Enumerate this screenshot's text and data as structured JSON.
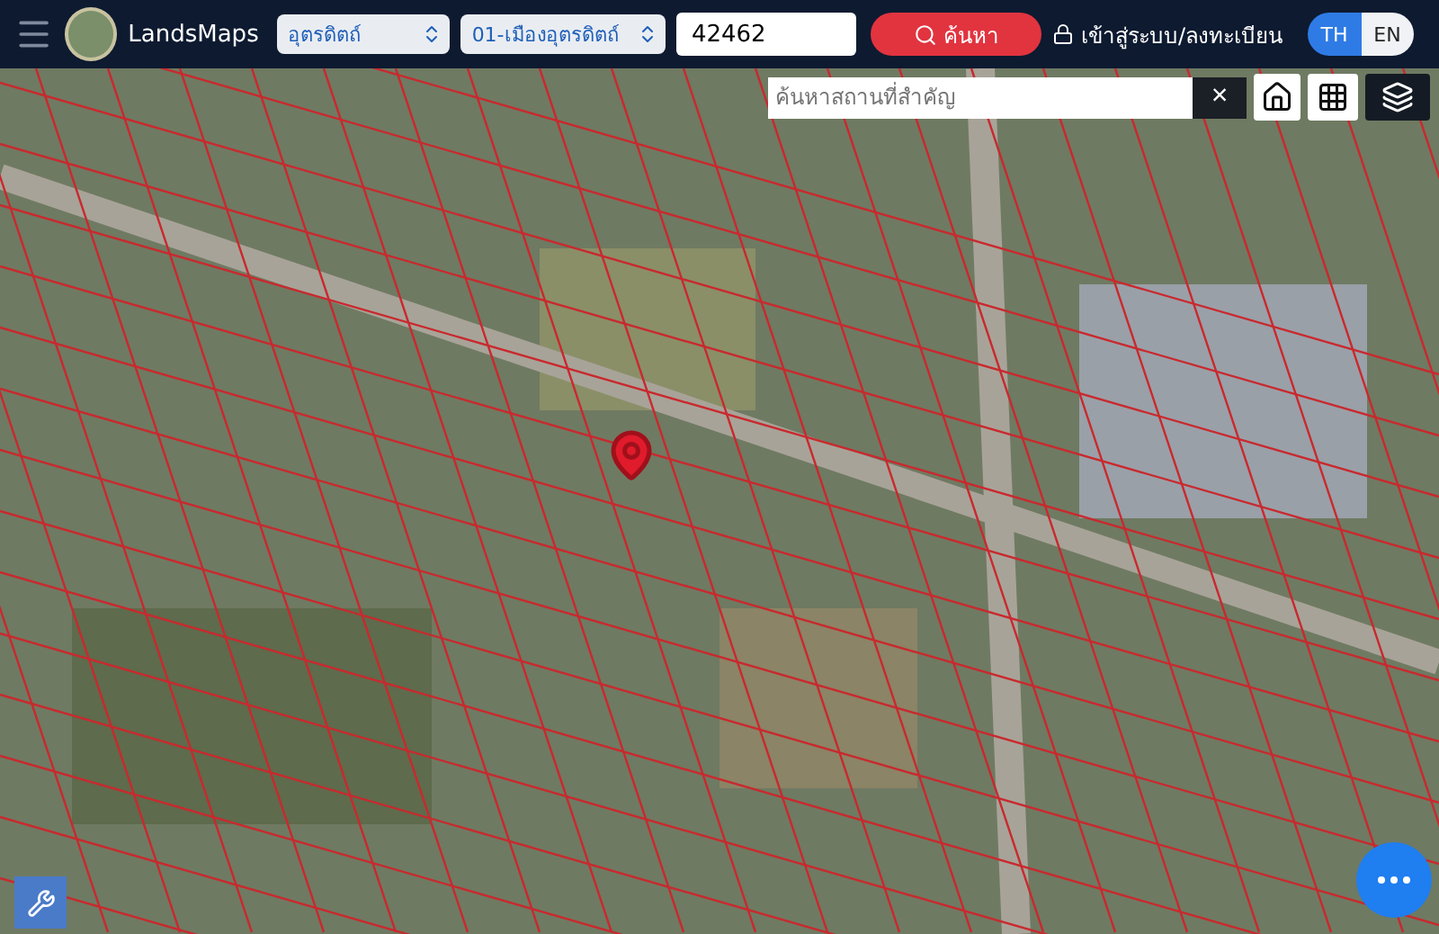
{
  "header": {
    "logo_text": "LandsMaps",
    "province": {
      "value": "อุตรดิตถ์"
    },
    "district": {
      "value": "01-เมืองอุตรดิตถ์"
    },
    "parcel": {
      "value": "42462"
    },
    "search_button": "ค้นหา",
    "login": "เข้าสู่ระบบ/ลงทะเบียน",
    "languages": [
      {
        "label": "TH",
        "selected": true
      },
      {
        "label": "EN",
        "selected": false
      }
    ]
  },
  "map": {
    "place_search": {
      "placeholder": "ค้นหาสถานที่สำคัญ"
    },
    "clear": "×"
  }
}
